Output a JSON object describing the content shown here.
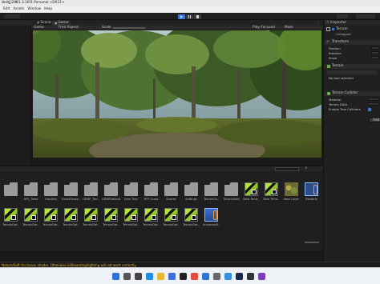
{
  "window": {
    "title": "Unity 2021.3.16f1 Personal <DX11>"
  },
  "menu": [
    "Edit",
    "Assets",
    "Window",
    "Help"
  ],
  "toolbar": {
    "play": "play",
    "pause": "pause",
    "step": "step"
  },
  "tabs": [
    {
      "label": "Scene",
      "icon": "scene-icon"
    },
    {
      "label": "Game",
      "icon": "game-icon"
    }
  ],
  "game_bar": {
    "display": "Game",
    "aspect": "Free Aspect",
    "scale_label": "Scale",
    "play_focused": "Play Focused",
    "mute": "Mute"
  },
  "inspector": {
    "tab": "Inspector",
    "object_name": "Terrain",
    "tag": "Untagged",
    "transform_title": "Transform",
    "transform_fields": [
      "Position",
      "Rotation",
      "Scale"
    ],
    "terrain_title": "Terrain",
    "no_tool": "No tool selected",
    "collider_title": "Terrain Collider",
    "collider_fields": [
      "Material",
      "Terrain Data",
      "Enable Tree Colliders"
    ],
    "add_button": "Add"
  },
  "project": {
    "row1": [
      {
        "label": "",
        "kind": "folder"
      },
      {
        "label": "AYS_Trees",
        "kind": "folder"
      },
      {
        "label": "Gardens",
        "kind": "folder"
      },
      {
        "label": "GrassFlowe..",
        "kind": "folder"
      },
      {
        "label": "HDRP_Terr..",
        "kind": "folder"
      },
      {
        "label": "HDRPDefault..",
        "kind": "folder"
      },
      {
        "label": "Jean Tree",
        "kind": "folder"
      },
      {
        "label": "RTP Grass",
        "kind": "folder"
      },
      {
        "label": "Scenes",
        "kind": "folder"
      },
      {
        "label": "Settings",
        "kind": "folder"
      },
      {
        "label": "TerrainSa..",
        "kind": "folder"
      },
      {
        "label": "TutorialInfo",
        "kind": "folder"
      },
      {
        "label": "New Terra..",
        "kind": "terrain"
      },
      {
        "label": "New Terra..",
        "kind": "terrain"
      },
      {
        "label": "New Layer",
        "kind": "grass"
      },
      {
        "label": "Readme",
        "kind": "readme"
      }
    ],
    "row2": [
      {
        "label": "TerrainDat..",
        "kind": "terrain"
      },
      {
        "label": "TerrainDat..",
        "kind": "terrain"
      },
      {
        "label": "TerrainDat..",
        "kind": "terrain"
      },
      {
        "label": "TerrainDat..",
        "kind": "terrain"
      },
      {
        "label": "TerrainDat..",
        "kind": "terrain"
      },
      {
        "label": "TerrainDat..",
        "kind": "terrain"
      },
      {
        "label": "TerrainDat..",
        "kind": "terrain"
      },
      {
        "label": "TerrainDat..",
        "kind": "terrain"
      },
      {
        "label": "TerrainDat..",
        "kind": "terrain"
      },
      {
        "label": "TerrainDat..",
        "kind": "terrain"
      },
      {
        "label": "UniversalR..",
        "kind": "prefab"
      }
    ]
  },
  "status": {
    "message": "Nature/Soft Occlusion shader. Otherwise billboarding/lighting will not work correctly."
  },
  "taskbar": {
    "icons": [
      "start-icon",
      "search-icon",
      "task-view-icon",
      "edge-icon",
      "file-explorer-icon",
      "store-icon",
      "unity-icon",
      "chrome-icon",
      "mail-icon",
      "settings-icon",
      "photos-icon",
      "steam-icon",
      "terminal-icon",
      "visual-studio-icon"
    ]
  },
  "colors": {
    "accent_blue": "#3a79d6",
    "status_warning": "#e5b33a",
    "terrain_green": "#b4e33a"
  }
}
